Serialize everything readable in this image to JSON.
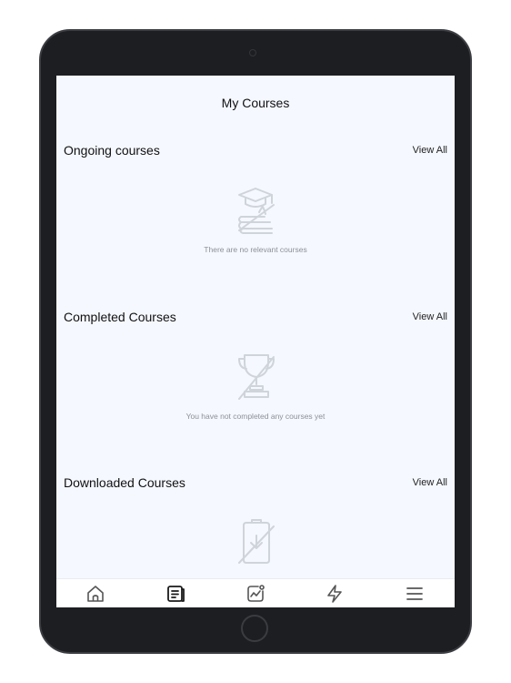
{
  "header": {
    "title": "My Courses"
  },
  "sections": [
    {
      "title": "Ongoing courses",
      "view_all": "View All",
      "empty_text": "There are no relevant courses",
      "icon": "graduation-books-icon"
    },
    {
      "title": "Completed Courses",
      "view_all": "View All",
      "empty_text": "You have not completed any courses yet",
      "icon": "trophy-icon"
    },
    {
      "title": "Downloaded Courses",
      "view_all": "View All",
      "empty_text": "",
      "icon": "download-device-icon"
    }
  ],
  "tabbar": {
    "items": [
      {
        "icon": "home-icon"
      },
      {
        "icon": "courses-icon",
        "active": true
      },
      {
        "icon": "progress-chart-icon"
      },
      {
        "icon": "lightning-icon"
      },
      {
        "icon": "menu-icon"
      }
    ]
  },
  "colors": {
    "screen_bg": "#f5f8ff",
    "muted_icon": "#cfd3da",
    "active_icon": "#1a1a1a",
    "inactive_icon": "#555"
  }
}
